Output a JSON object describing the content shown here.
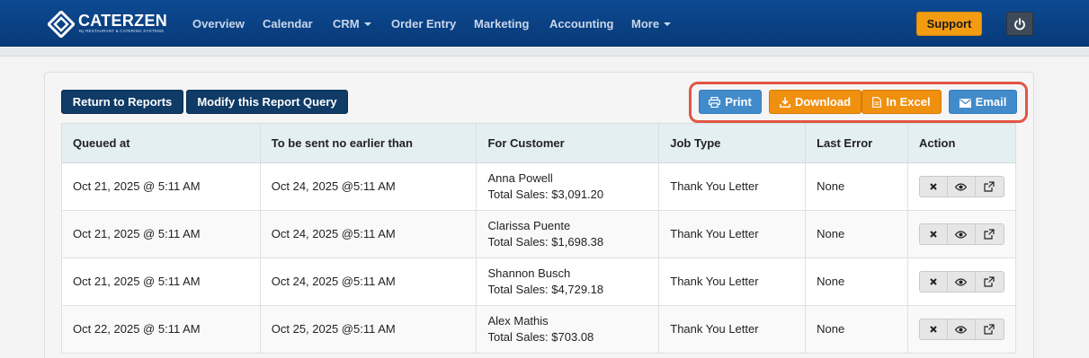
{
  "brand": {
    "name": "CATERZEN",
    "tagline": "By RESTAURANT & CATERING SYSTEMS"
  },
  "nav": {
    "items": [
      {
        "label": "Overview"
      },
      {
        "label": "Calendar"
      },
      {
        "label": "CRM",
        "dropdown": true
      },
      {
        "label": "Order Entry"
      },
      {
        "label": "Marketing"
      },
      {
        "label": "Accounting"
      },
      {
        "label": "More",
        "dropdown": true
      }
    ],
    "support_label": "Support",
    "power_icon": "power-icon"
  },
  "toolbar": {
    "return_label": "Return to Reports",
    "modify_label": "Modify this Report Query",
    "print_label": "Print",
    "download_label": "Download",
    "excel_label": "In Excel",
    "email_label": "Email"
  },
  "table": {
    "headers": [
      "Queued at",
      "To be sent no earlier than",
      "For Customer",
      "Job Type",
      "Last Error",
      "Action"
    ],
    "rows": [
      {
        "queued": "Oct 21, 2025 @ 5:11 AM",
        "send_after": "Oct 24, 2025 @5:11 AM",
        "customer": "Anna Powell",
        "sales": "Total Sales: $3,091.20",
        "job_type": "Thank You Letter",
        "last_error": "None"
      },
      {
        "queued": "Oct 21, 2025 @ 5:11 AM",
        "send_after": "Oct 24, 2025 @5:11 AM",
        "customer": "Clarissa Puente",
        "sales": "Total Sales: $1,698.38",
        "job_type": "Thank You Letter",
        "last_error": "None"
      },
      {
        "queued": "Oct 21, 2025 @ 5:11 AM",
        "send_after": "Oct 24, 2025 @5:11 AM",
        "customer": "Shannon Busch",
        "sales": "Total Sales: $4,729.18",
        "job_type": "Thank You Letter",
        "last_error": "None"
      },
      {
        "queued": "Oct 22, 2025 @ 5:11 AM",
        "send_after": "Oct 25, 2025 @5:11 AM",
        "customer": "Alex Mathis",
        "sales": "Total Sales: $703.08",
        "job_type": "Thank You Letter",
        "last_error": "None"
      }
    ]
  },
  "colors": {
    "navbar": "#0d4a92",
    "support": "#f39c12",
    "primary_dark": "#0f3b66",
    "info_blue": "#428bca",
    "warning_orange": "#f0900f",
    "highlight": "#e25545"
  }
}
